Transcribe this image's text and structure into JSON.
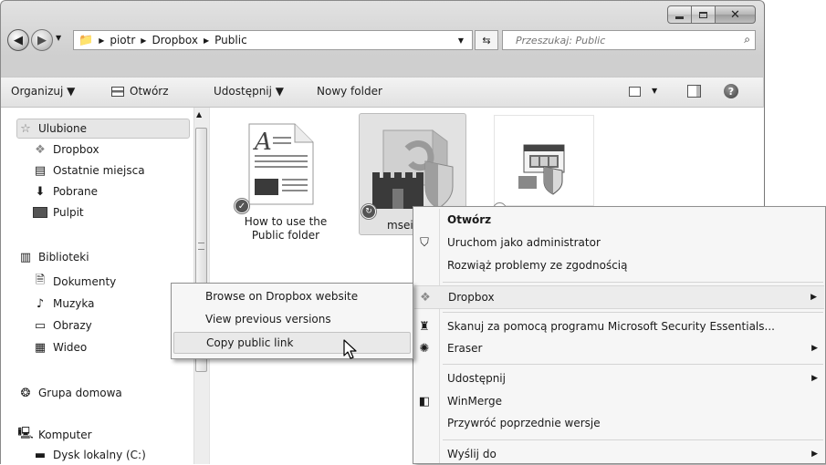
{
  "address": {
    "segments": [
      "piotr",
      "Dropbox",
      "Public"
    ]
  },
  "search": {
    "placeholder": "Przeszukaj: Public"
  },
  "toolbar": {
    "organize": "Organizuj ▼",
    "open": "Otwórz",
    "share": "Udostępnij ▼",
    "new_folder": "Nowy folder"
  },
  "nav": {
    "favorites": "Ulubione",
    "dropbox": "Dropbox",
    "recent": "Ostatnie miejsca",
    "downloads": "Pobrane",
    "desktop": "Pulpit",
    "libraries": "Biblioteki",
    "documents": "Dokumenty",
    "music": "Muzyka",
    "pictures": "Obrazy",
    "video": "Wideo",
    "homegroup": "Grupa domowa",
    "computer": "Komputer",
    "local_disk": "Dysk lokalny (C:)"
  },
  "files": [
    {
      "line1": "How to use the",
      "line2": "Public folder"
    },
    {
      "line1": "msei"
    }
  ],
  "menu_main": {
    "open": "Otwórz",
    "run_as_admin": "Uruchom jako administrator",
    "troubleshoot": "Rozwiąż problemy ze zgodnością",
    "dropbox": "Dropbox",
    "scan": "Skanuj za pomocą programu Microsoft Security Essentials...",
    "eraser": "Eraser",
    "share": "Udostępnij",
    "winmerge": "WinMerge",
    "restore": "Przywróć poprzednie wersje",
    "send_to": "Wyślij do"
  },
  "menu_sub": {
    "browse": "Browse on Dropbox website",
    "versions": "View previous versions",
    "copy_link": "Copy public link"
  },
  "colors": {
    "menu_bg": "#f6f6f6",
    "highlight": "#e8eef7",
    "frame": "#d4d4d4"
  }
}
